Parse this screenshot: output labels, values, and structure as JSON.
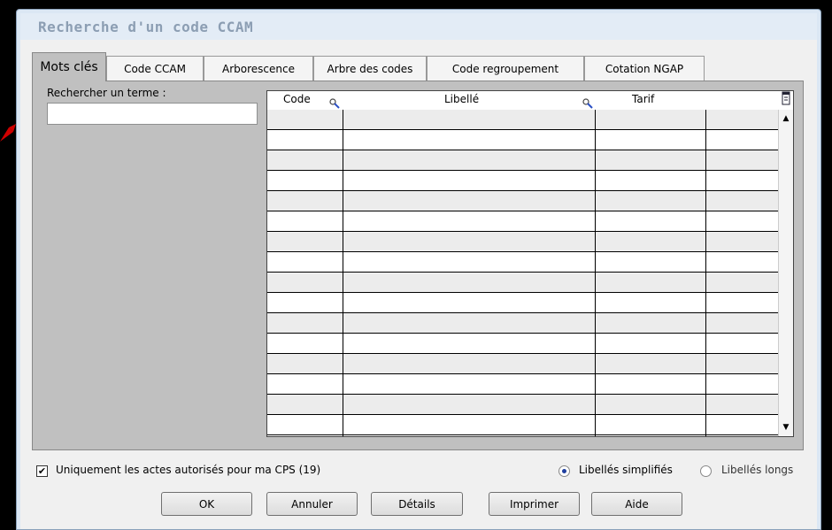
{
  "window": {
    "title": "Recherche d'un code CCAM"
  },
  "tabs": [
    {
      "label": "Mots clés",
      "active": true
    },
    {
      "label": "Code CCAM"
    },
    {
      "label": "Arborescence"
    },
    {
      "label": "Arbre des codes"
    },
    {
      "label": "Code regroupement"
    },
    {
      "label": "Cotation NGAP"
    }
  ],
  "search": {
    "label": "Rechercher un terme :",
    "value": "",
    "placeholder": ""
  },
  "table": {
    "columns": [
      "Code",
      "Libellé",
      "Tarif"
    ],
    "row_count": 15,
    "icons": {
      "sort": "magnifier-sort-icon",
      "columns": "column-chooser-icon"
    }
  },
  "options": {
    "authorized_only_label": "Uniquement les actes autorisés pour ma CPS (19)",
    "authorized_only_checked": true,
    "simplified_label": "Libellés simplifiés",
    "long_label": "Libellés longs",
    "selected": "simplified"
  },
  "buttons": {
    "ok": "OK",
    "cancel": "Annuler",
    "details": "Détails",
    "print": "Imprimer",
    "help": "Aide"
  },
  "colors": {
    "accent_arrow": "#d00000",
    "title_text": "#8c9eb3",
    "panel_bg": "#c0c0c0"
  }
}
